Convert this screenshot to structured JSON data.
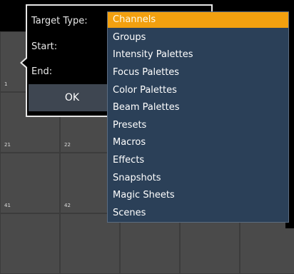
{
  "grid": {
    "cell_numbers": [
      "1",
      "21",
      "22",
      "41",
      "42"
    ]
  },
  "dialog": {
    "target_type_label": "Target Type:",
    "start_label": "Start:",
    "end_label": "End:",
    "ok_label": "OK"
  },
  "dropdown": {
    "selected_index": 0,
    "items": [
      "Channels",
      "Groups",
      "Intensity Palettes",
      "Focus Palettes",
      "Color Palettes",
      "Beam Palettes",
      "Presets",
      "Macros",
      "Effects",
      "Snapshots",
      "Magic Sheets",
      "Scenes"
    ]
  },
  "colors": {
    "highlight": "#f2a00f",
    "list_background": "#2b4058",
    "button_background": "#3e4651"
  }
}
